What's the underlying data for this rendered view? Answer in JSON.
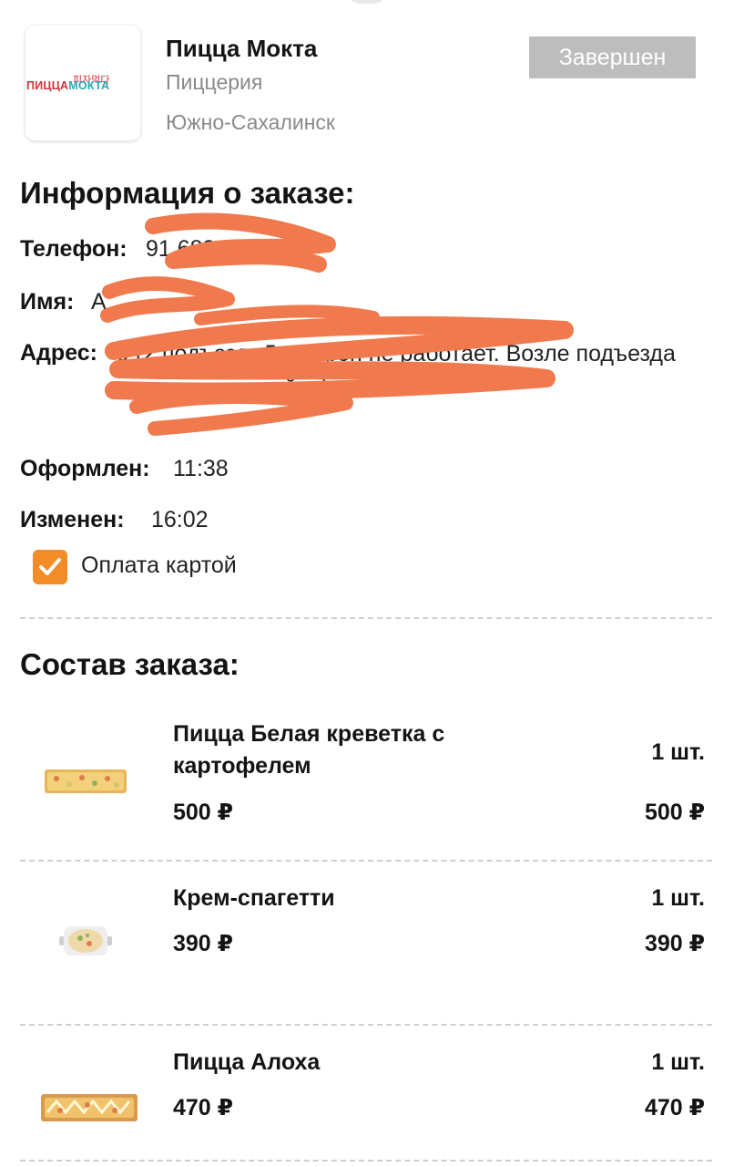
{
  "restaurant": {
    "logo_korean": "피자먹다",
    "logo_text_part1": "ПИЦЦА",
    "logo_text_part2": "МОКТА",
    "name": "Пицца Мокта",
    "type": "Пиццерия",
    "city": "Южно-Сахалинск",
    "status": "Завершен"
  },
  "order_info": {
    "title": "Информация о заказе:",
    "phone_label": "Телефон:",
    "phone_value": "91        683",
    "name_label": "Имя:",
    "name_value": "А",
    "address_label": "Адрес:",
    "address_value": "                                    9 (2 подъезд. Домофон не работает. Возле подъезда позвоните, я выйду)",
    "placed_label": "Оформлен:",
    "placed_value": "11:38",
    "changed_label": "Изменен:",
    "changed_value": "16:02",
    "payment_label": "Оплата картой",
    "payment_checked": true
  },
  "items_section": {
    "title": "Состав заказа:"
  },
  "items": [
    {
      "name": "Пицца Белая креветка с картофелем",
      "price": "500 ₽",
      "qty": "1 шт.",
      "total": "500 ₽"
    },
    {
      "name": "Крем-спагетти",
      "price": "390 ₽",
      "qty": "1 шт.",
      "total": "390 ₽"
    },
    {
      "name": "Пицца Алоха",
      "price": "470 ₽",
      "qty": "1 шт.",
      "total": "470 ₽"
    }
  ],
  "colors": {
    "accent_orange": "#f28c28",
    "redaction": "#f07a4e",
    "badge_gray": "#bdbdbd",
    "logo_red": "#d9303a",
    "logo_teal": "#2aa6b2"
  }
}
